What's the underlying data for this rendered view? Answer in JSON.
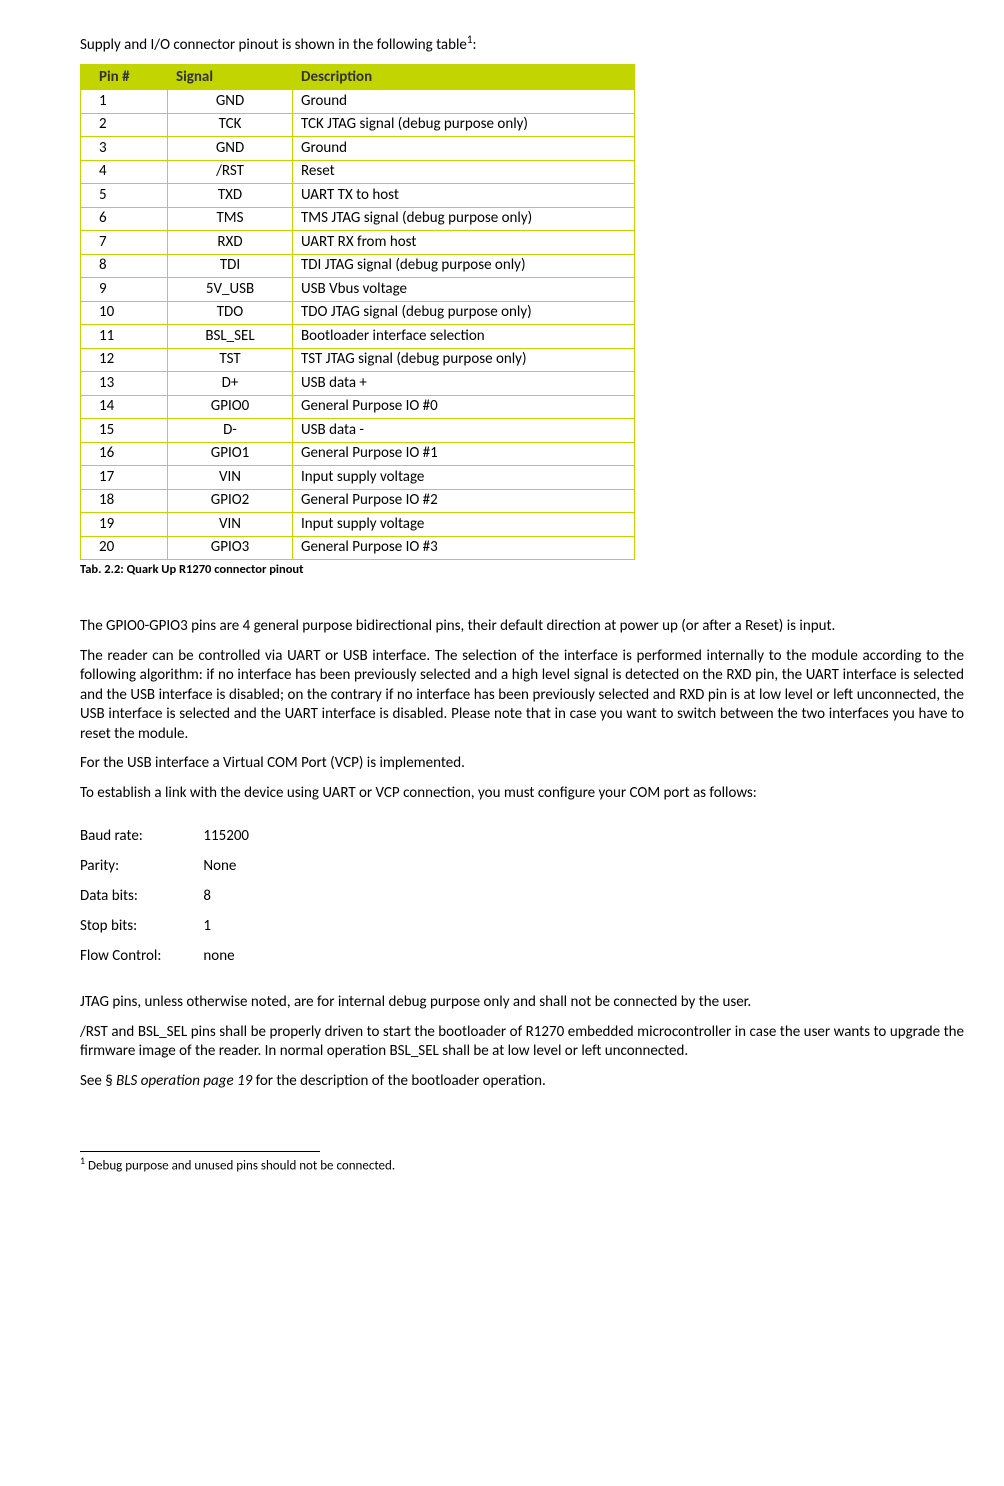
{
  "intro_text_prefix": "Supply and I/O connector pinout is shown in the following table",
  "intro_sup": "1",
  "intro_text_suffix": ":",
  "table": {
    "headers": {
      "pin": "Pin #",
      "signal": "Signal",
      "desc": "Description"
    },
    "rows": [
      {
        "pin": "1",
        "signal": "GND",
        "desc": "Ground"
      },
      {
        "pin": "2",
        "signal": "TCK",
        "desc": "TCK JTAG signal (debug purpose only)"
      },
      {
        "pin": "3",
        "signal": "GND",
        "desc": "Ground"
      },
      {
        "pin": "4",
        "signal": "/RST",
        "desc": "Reset"
      },
      {
        "pin": "5",
        "signal": "TXD",
        "desc": "UART TX to host"
      },
      {
        "pin": "6",
        "signal": "TMS",
        "desc": "TMS JTAG signal (debug purpose only)"
      },
      {
        "pin": "7",
        "signal": "RXD",
        "desc": "UART RX from host"
      },
      {
        "pin": "8",
        "signal": "TDI",
        "desc": "TDI JTAG signal (debug purpose only)"
      },
      {
        "pin": "9",
        "signal": "5V_USB",
        "desc": "USB Vbus voltage"
      },
      {
        "pin": "10",
        "signal": "TDO",
        "desc": "TDO JTAG signal (debug purpose only)"
      },
      {
        "pin": "11",
        "signal": "BSL_SEL",
        "desc": "Bootloader interface selection"
      },
      {
        "pin": "12",
        "signal": "TST",
        "desc": "TST JTAG signal (debug purpose only)"
      },
      {
        "pin": "13",
        "signal": "D+",
        "desc": "USB data +"
      },
      {
        "pin": "14",
        "signal": "GPIO0",
        "desc": "General Purpose IO #0"
      },
      {
        "pin": "15",
        "signal": "D-",
        "desc": "USB data -"
      },
      {
        "pin": "16",
        "signal": "GPIO1",
        "desc": "General Purpose IO #1"
      },
      {
        "pin": "17",
        "signal": "VIN",
        "desc": "Input supply voltage"
      },
      {
        "pin": "18",
        "signal": "GPIO2",
        "desc": "General Purpose IO #2"
      },
      {
        "pin": "19",
        "signal": "VIN",
        "desc": "Input supply voltage"
      },
      {
        "pin": "20",
        "signal": "GPIO3",
        "desc": "General Purpose IO #3"
      }
    ]
  },
  "caption": "Tab. 2.2: Quark Up R1270 connector pinout",
  "paragraphs": {
    "p1": "The GPIO0-GPIO3 pins are 4 general purpose bidirectional pins, their default direction at power up (or after a Reset) is input.",
    "p2": "The reader can be controlled via UART or USB interface. The selection of the interface is performed internally to the module according to the following algorithm: if no interface has been previously selected and a high level signal is detected on the RXD pin, the UART interface is selected and the USB interface is disabled; on the contrary if no interface has been previously selected and RXD pin is at low level or left unconnected, the USB interface is selected and the UART interface is disabled.  Please note that in case you want to switch between the two interfaces you have to reset the module.",
    "p3": "For the USB interface a Virtual COM Port (VCP) is implemented.",
    "p4": "To establish a link with the device using UART or VCP connection, you must configure your COM port as follows:",
    "p5": "JTAG pins, unless otherwise noted, are for internal debug purpose only and shall not be connected by the user.",
    "p6": "/RST and BSL_SEL pins shall be properly driven to start the bootloader of R1270 embedded microcontroller in case the user wants to upgrade the firmware image of the reader. In normal operation BSL_SEL shall be at low level or left unconnected.",
    "p7_prefix": "See § ",
    "p7_italic": "BLS operation page 19",
    "p7_suffix": " for the description of the bootloader operation."
  },
  "comport": {
    "baud_label": "Baud rate:",
    "baud_value": "115200",
    "parity_label": "Parity:",
    "parity_value": "None",
    "databits_label": "Data bits:",
    "databits_value": "8",
    "stopbits_label": "Stop bits:",
    "stopbits_value": "1",
    "flow_label": "Flow Control:",
    "flow_value": "none"
  },
  "footnote": {
    "marker": "1",
    "text": " Debug purpose and unused pins should not be connected."
  }
}
